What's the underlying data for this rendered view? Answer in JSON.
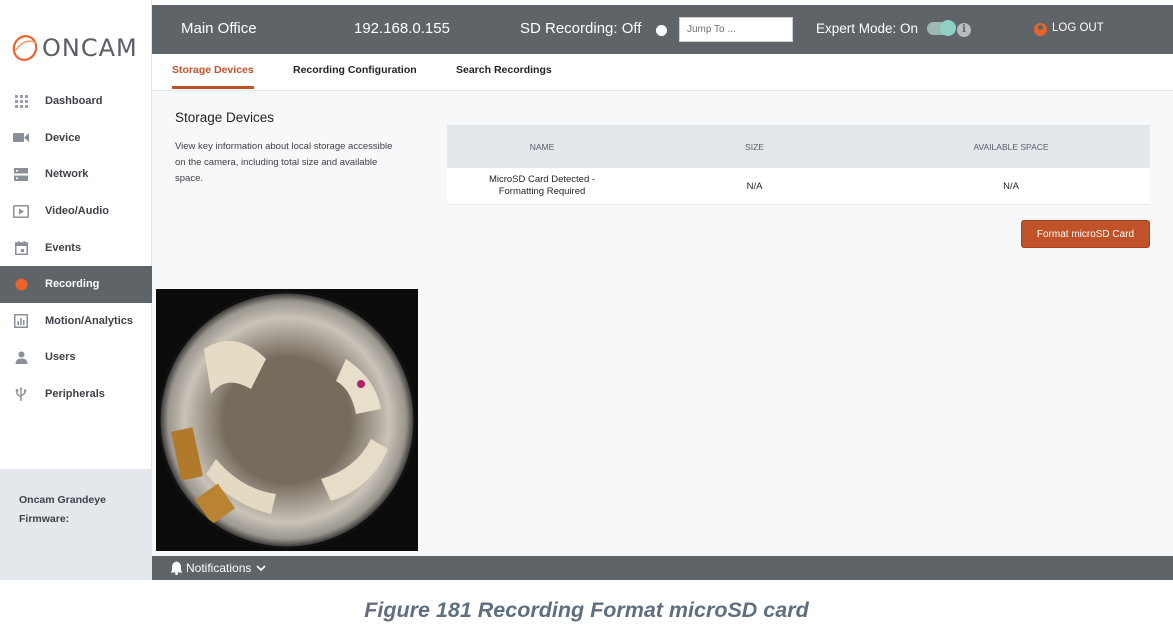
{
  "brand": {
    "name": "ONCAM",
    "accent": "#e8642c"
  },
  "topbar": {
    "location": "Main Office",
    "ip": "192.168.0.155",
    "sd_recording": "SD Recording: Off",
    "jump_placeholder": "Jump To ...",
    "expert_mode": "Expert Mode: On",
    "expert_mode_enabled": true,
    "logout": "LOG OUT"
  },
  "sidebar": {
    "items": [
      {
        "label": "Dashboard",
        "icon": "grid-icon"
      },
      {
        "label": "Device",
        "icon": "camera-icon"
      },
      {
        "label": "Network",
        "icon": "server-icon"
      },
      {
        "label": "Video/Audio",
        "icon": "play-icon"
      },
      {
        "label": "Events",
        "icon": "calendar-icon"
      },
      {
        "label": "Recording",
        "icon": "record-dot-icon",
        "active": true
      },
      {
        "label": "Motion/Analytics",
        "icon": "chart-icon"
      },
      {
        "label": "Users",
        "icon": "user-icon"
      },
      {
        "label": "Peripherals",
        "icon": "usb-icon"
      }
    ],
    "footer": {
      "model": "Oncam Grandeye",
      "firmware_label": "Firmware:"
    }
  },
  "tabs": [
    {
      "label": "Storage Devices",
      "active": true
    },
    {
      "label": "Recording Configuration"
    },
    {
      "label": "Search Recordings"
    }
  ],
  "storage": {
    "title": "Storage Devices",
    "description": "View key information about local storage accessible on the camera, including total size and available space.",
    "columns": [
      "NAME",
      "SIZE",
      "AVAILABLE SPACE"
    ],
    "rows": [
      {
        "name_line1": "MicroSD Card Detected -",
        "name_line2": "Formatting Required",
        "size": "N/A",
        "available": "N/A"
      }
    ],
    "format_button": "Format microSD Card"
  },
  "notifications": {
    "label": "Notifications"
  },
  "caption": "Figure 181 Recording Format microSD card"
}
